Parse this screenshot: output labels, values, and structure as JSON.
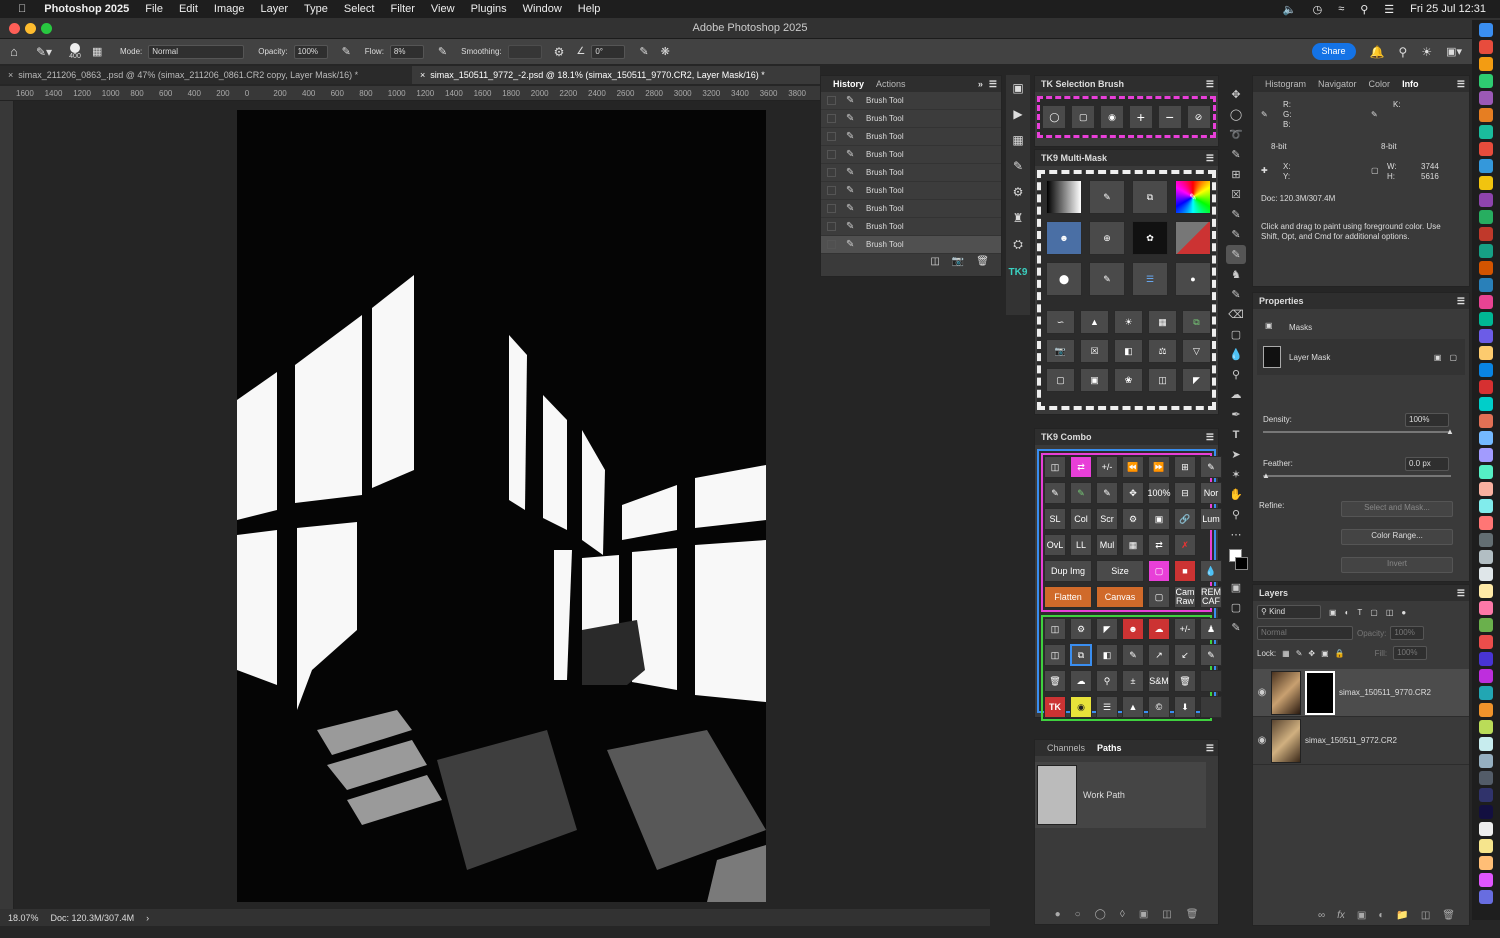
{
  "menubar": {
    "app_name": "Photoshop 2025",
    "items": [
      "File",
      "Edit",
      "Image",
      "Layer",
      "Type",
      "Select",
      "Filter",
      "View",
      "Plugins",
      "Window",
      "Help"
    ],
    "datetime": "Fri 25 Jul  12:31"
  },
  "window": {
    "title": "Adobe Photoshop 2025"
  },
  "options": {
    "brush_size": "400",
    "mode_label": "Mode:",
    "mode_value": "Normal",
    "opacity_label": "Opacity:",
    "opacity_value": "100%",
    "flow_label": "Flow:",
    "flow_value": "8%",
    "smoothing_label": "Smoothing:",
    "smoothing_value": "",
    "angle_value": "0°",
    "share_label": "Share"
  },
  "tabs": [
    {
      "label": "simax_211206_0863_.psd @ 47% (simax_211206_0861.CR2 copy, Layer Mask/16) *",
      "active": false
    },
    {
      "label": "simax_150511_9772_-2.psd @ 18.1% (simax_150511_9770.CR2, Layer Mask/16) *",
      "active": true
    }
  ],
  "ruler_labels": [
    "1600",
    "1400",
    "1200",
    "1000",
    "800",
    "600",
    "400",
    "200",
    "0",
    "200",
    "400",
    "600",
    "800",
    "1000",
    "1200",
    "1400",
    "1600",
    "1800",
    "2000",
    "2200",
    "2400",
    "2600",
    "2800",
    "3000",
    "3200",
    "3400",
    "3600",
    "3800"
  ],
  "status": {
    "zoom": "18.07%",
    "doc": "Doc: 120.3M/307.4M"
  },
  "history": {
    "tabs": [
      "History",
      "Actions"
    ],
    "items": [
      "Brush Tool",
      "Brush Tool",
      "Brush Tool",
      "Brush Tool",
      "Brush Tool",
      "Brush Tool",
      "Brush Tool",
      "Brush Tool",
      "Brush Tool"
    ]
  },
  "tk_selection": {
    "title": "TK Selection Brush"
  },
  "tk_multimask": {
    "title": "TK9 Multi-Mask"
  },
  "tk_combo": {
    "title": "TK9 Combo",
    "rows": [
      [
        "",
        "",
        "+/-",
        "",
        "",
        "",
        "",
        "100%",
        ""
      ],
      [
        "Nor",
        "SL",
        "Col",
        "Scr",
        "",
        "",
        "",
        "",
        ""
      ],
      [
        "Lum",
        "OvL",
        "LL",
        "Mul",
        "",
        "",
        "",
        "",
        ""
      ],
      [
        "Dup Img",
        "",
        "Size",
        "",
        "",
        "",
        "",
        "",
        ""
      ],
      [
        "Flatten",
        "",
        "Canvas",
        "",
        "",
        "",
        "Cam Raw",
        "REM CAF",
        ""
      ]
    ],
    "row9_labels": [
      "+/-",
      "S&M"
    ],
    "tk_label": "TK"
  },
  "channels": {
    "tabs": [
      "Channels",
      "Paths"
    ],
    "path_name": "Work Path"
  },
  "info": {
    "tabs": [
      "Histogram",
      "Navigator",
      "Color",
      "Info"
    ],
    "r": "R:",
    "g": "G:",
    "b": "B:",
    "k": "K:",
    "bit_left": "8-bit",
    "bit_right": "8-bit",
    "x": "X:",
    "y": "Y:",
    "w": "W:",
    "h": "H:",
    "w_value": "3744",
    "h_value": "5616",
    "doc": "Doc: 120.3M/307.4M",
    "hint": "Click and drag to paint using foreground color.  Use Shift, Opt, and Cmd for additional options."
  },
  "properties": {
    "title": "Properties",
    "masks_label": "Masks",
    "layer_mask_label": "Layer Mask",
    "density_label": "Density:",
    "density_value": "100%",
    "density_pct": 100,
    "feather_label": "Feather:",
    "feather_value": "0.0 px",
    "feather_pct": 0,
    "refine_label": "Refine:",
    "select_mask": "Select and Mask...",
    "color_range": "Color Range...",
    "invert": "Invert"
  },
  "layers": {
    "title": "Layers",
    "kind_label": "Kind",
    "blend": "Normal",
    "opacity_label": "Opacity:",
    "opacity_value": "100%",
    "lock_label": "Lock:",
    "fill_label": "Fill:",
    "fill_value": "100%",
    "items": [
      {
        "name": "simax_150511_9770.CR2",
        "selected": true
      },
      {
        "name": "simax_150511_9772.CR2",
        "selected": false
      }
    ]
  },
  "colors": {
    "accent": "#1473e6",
    "magenta": "#e83fd8",
    "blue": "#3a8ef0",
    "green": "#3fd13f",
    "yellow": "#e8e23a"
  }
}
